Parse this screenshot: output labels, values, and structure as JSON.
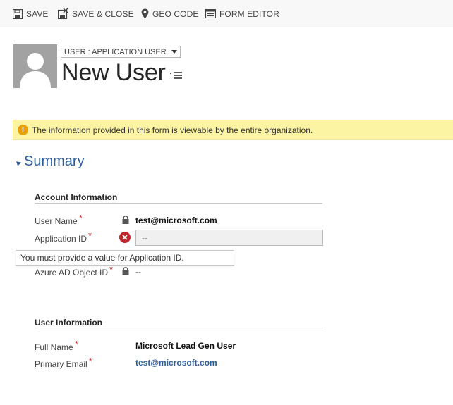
{
  "toolbar": {
    "save": "SAVE",
    "save_close": "SAVE & CLOSE",
    "geo_code": "GEO CODE",
    "form_editor": "FORM EDITOR"
  },
  "header": {
    "form_selector": "USER : APPLICATION USER",
    "title": "New User"
  },
  "notification": {
    "text": "The information provided in this form is viewable by the entire organization."
  },
  "summary": {
    "title": "Summary",
    "account_info": {
      "title": "Account Information",
      "user_name_label": "User Name",
      "user_name_value": "test@microsoft.com",
      "app_id_label": "Application ID",
      "app_id_value": "--",
      "app_id_error": "You must provide a value for Application ID.",
      "azure_label": "Azure AD Object ID",
      "azure_value": "--"
    },
    "user_info": {
      "title": "User Information",
      "full_name_label": "Full Name",
      "full_name_value": "Microsoft Lead Gen User",
      "email_label": "Primary Email",
      "email_value": "test@microsoft.com"
    }
  },
  "required_marker": "*",
  "warning_glyph": "!",
  "colors": {
    "accent": "#2e5f9c",
    "required": "#c0272d",
    "notice_bg": "#fcf4a3",
    "warning": "#e8a108"
  }
}
